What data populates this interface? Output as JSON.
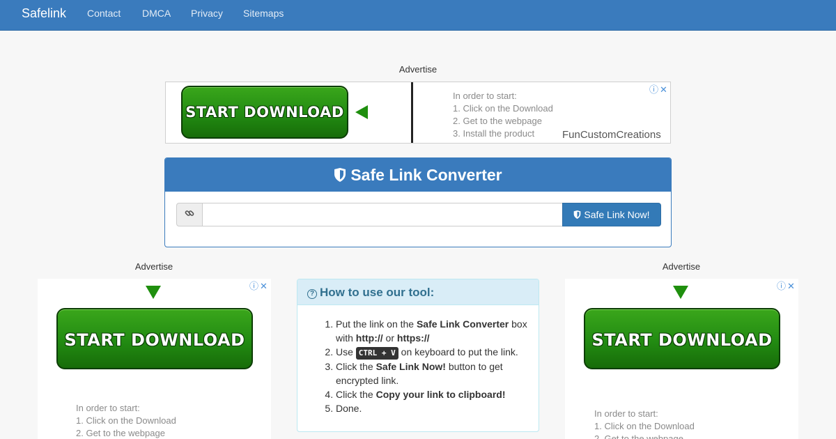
{
  "navbar": {
    "brand": "Safelink",
    "links": [
      "Contact",
      "DMCA",
      "Privacy",
      "Sitemaps"
    ]
  },
  "ads": {
    "label": "Advertise",
    "download_text": "START DOWNLOAD",
    "steps_title": "In order to start:",
    "steps": [
      "1. Click on the Download",
      "2. Get to the webpage",
      "3. Install the product"
    ],
    "sponsor": "FunCustomCreations",
    "adchoices": "ⓘ✕"
  },
  "converter": {
    "title": "Safe Link Converter",
    "input_value": "",
    "input_placeholder": "",
    "button_label": "Safe Link Now!"
  },
  "howto": {
    "title": "How to use our tool:",
    "step1_a": "Put the link on the ",
    "step1_b": "Safe Link Converter",
    "step1_c": " box with ",
    "step1_d": "http://",
    "step1_e": " or ",
    "step1_f": "https://",
    "step2_a": "Use ",
    "step2_kbd": "CTRL + V",
    "step2_b": " on keyboard to put the link.",
    "step3_a": "Click the ",
    "step3_b": "Safe Link Now!",
    "step3_c": " button to get encrypted link.",
    "step4_a": "Click the ",
    "step4_b": "Copy your link to clipboard!",
    "step5": "Done."
  },
  "colors": {
    "navbar": "#3a7bbd",
    "panel_header": "#3a7bbd",
    "button": "#337ab7",
    "download_green": "#228b12",
    "info_bg": "#d9edf7"
  }
}
